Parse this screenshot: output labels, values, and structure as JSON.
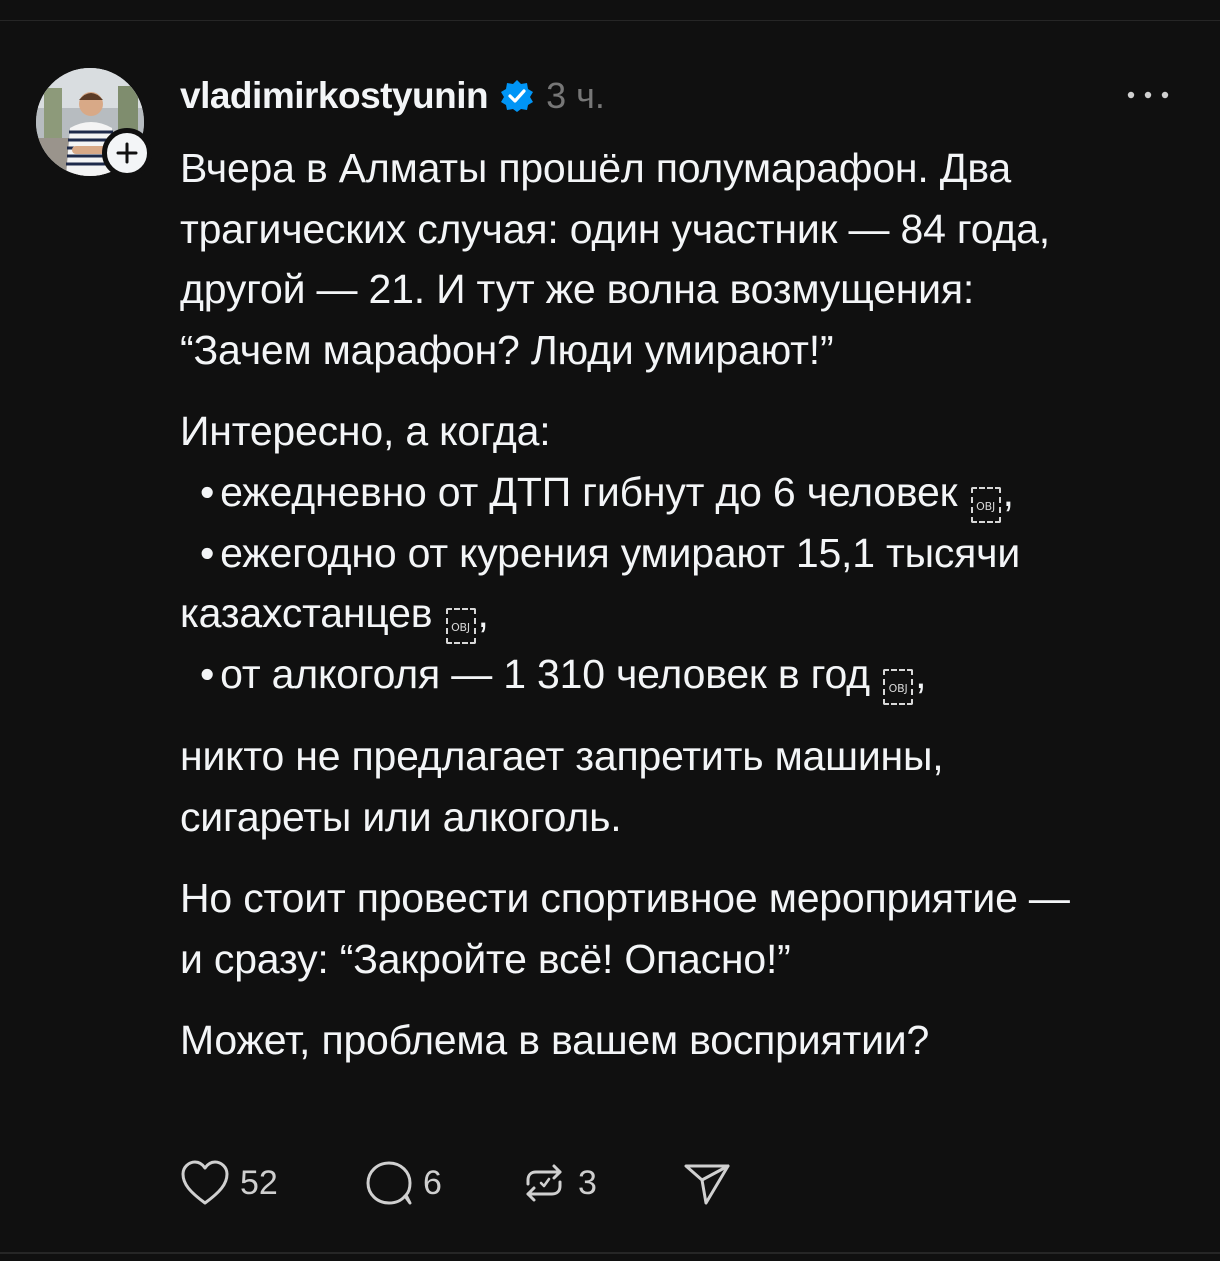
{
  "post": {
    "username": "vladimirkostyunin",
    "time": "3 ч.",
    "paragraphs": [
      [
        "Вчера в Алматы прошёл полумарафон. Два",
        "трагических случая: один участник — 84 года,",
        "другой — 21. И тут же волна возмущения:",
        "“Зачем марафон? Люди умирают!”"
      ],
      [
        "Интересно, а когда:"
      ]
    ],
    "bullets": {
      "b1": "ежедневно от ДТП гибнут до 6 человек",
      "b2": "ежегодно от курения умирают 15,1 тысячи",
      "b2_cont": "казахстанцев",
      "b3": "от алкоголя — 1 310 человек в год",
      "comma": ","
    },
    "para3": [
      "никто не предлагает запретить машины,",
      "сигареты или алкоголь."
    ],
    "para4": [
      "Но стоит провести спортивное мероприятие —",
      "и сразу: “Закройте всё! Опасно!”"
    ],
    "para5": [
      "Может, проблема в вашем восприятии?"
    ],
    "obj_glyph": "OBJ"
  },
  "actions": {
    "likes": "52",
    "replies": "6",
    "reposts": "3"
  },
  "icons": {
    "verified": "verified-badge-icon",
    "follow": "plus-icon",
    "more": "more-dots-icon",
    "like": "heart-icon",
    "reply": "comment-bubble-icon",
    "repost": "repost-icon",
    "share": "send-icon"
  },
  "colors": {
    "background": "#101010",
    "text": "#f3f5f7",
    "muted": "#777777",
    "verified": "#0095f6"
  }
}
